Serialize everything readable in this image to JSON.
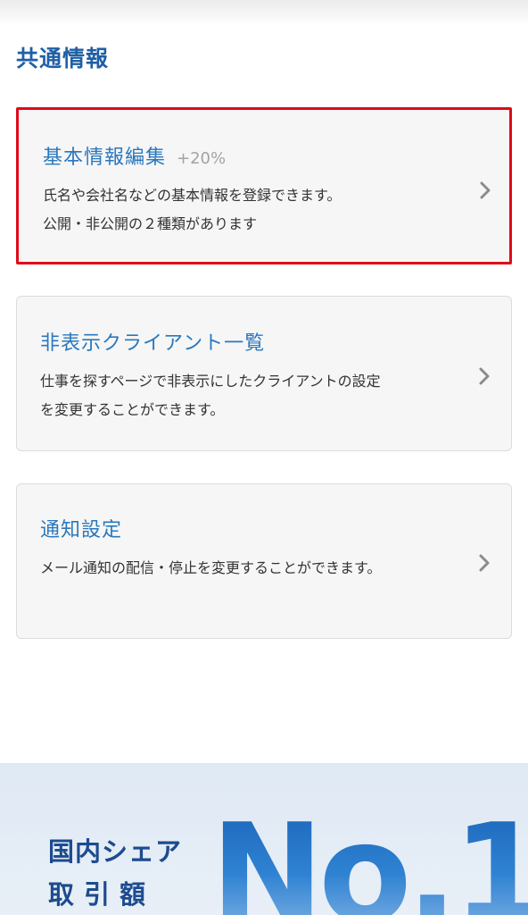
{
  "section": {
    "title": "共通情報"
  },
  "cards": [
    {
      "title": "基本情報編集",
      "badge": "+20%",
      "description_lines": [
        "氏名や会社名などの基本情報を登録できます。",
        "公開・非公開の２種類があります"
      ],
      "highlighted": true,
      "arrow_icon": "chevron-right-icon"
    },
    {
      "title": "非表示クライアント一覧",
      "description_lines": [
        "仕事を探すページで非表示にしたクライアントの設定",
        "を変更することができます。"
      ],
      "highlighted": false,
      "arrow_icon": "chevron-right-icon"
    },
    {
      "title": "通知設定",
      "description_lines": [
        "メール通知の配信・停止を変更することができます。"
      ],
      "highlighted": false,
      "arrow_icon": "chevron-right-icon"
    }
  ],
  "banner": {
    "line1": "国内シェア",
    "line2": "取引額",
    "headline": "No.1"
  },
  "colors": {
    "section_title": "#1f5fa6",
    "card_title": "#2a78bd",
    "badge": "#a3a3a3",
    "highlight_border": "#e00a1a",
    "card_background": "#f6f6f6",
    "banner_background": "#e4edf6",
    "banner_text": "#1d4b8f",
    "headline_blue": "#1c67bb"
  }
}
